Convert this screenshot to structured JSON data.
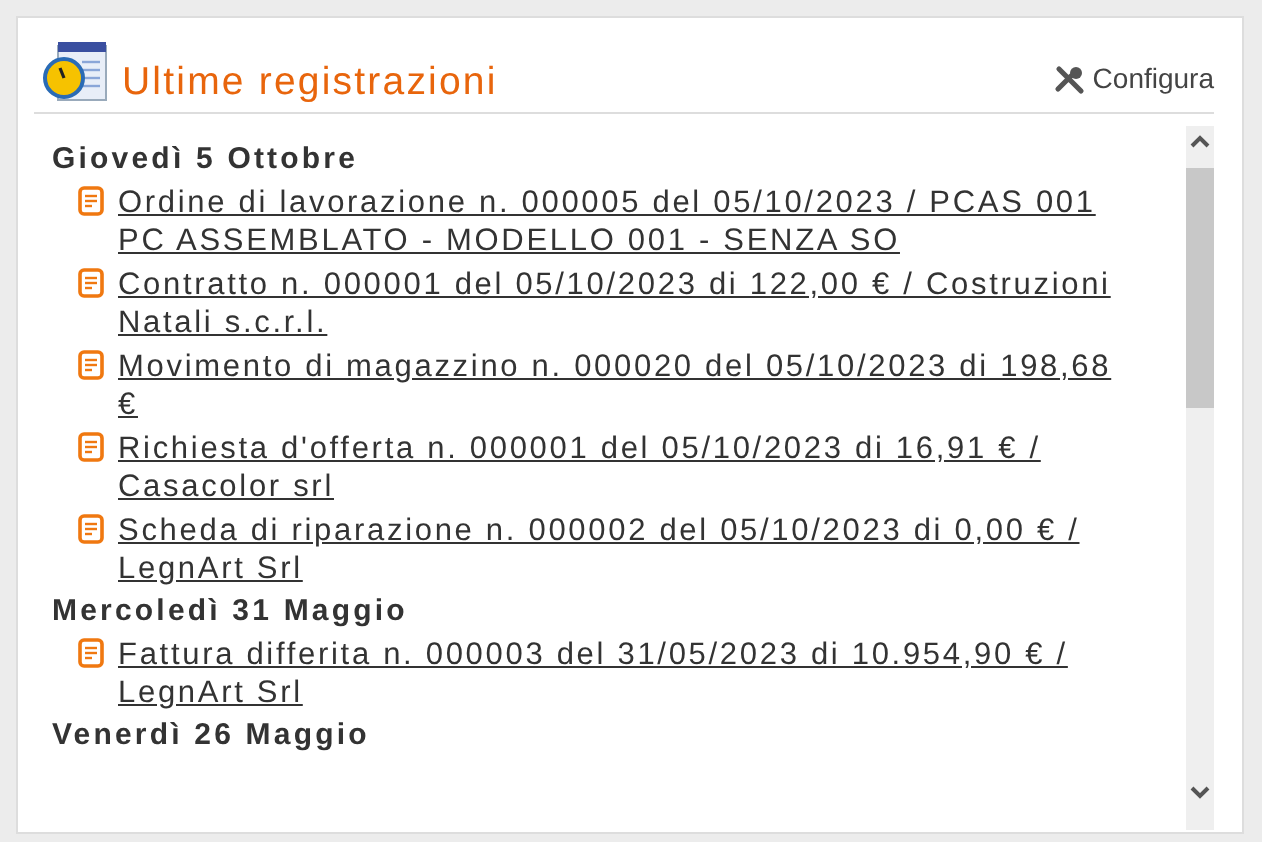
{
  "widget": {
    "title": "Ultime registrazioni",
    "action": "Configura"
  },
  "groups": [
    {
      "date": "Giovedì 5 Ottobre",
      "items": [
        "Ordine di lavorazione n. 000005 del 05/10/2023 / PCAS 001 PC ASSEMBLATO - MODELLO 001 - SENZA SO",
        "Contratto n. 000001 del 05/10/2023 di 122,00 € / Costruzioni Natali s.c.r.l.",
        "Movimento di magazzino n. 000020 del 05/10/2023 di 198,68 €",
        "Richiesta d'offerta n. 000001 del 05/10/2023 di 16,91 € / Casacolor srl",
        "Scheda di riparazione n. 000002 del 05/10/2023 di 0,00 € / LegnArt Srl"
      ]
    },
    {
      "date": "Mercoledì 31 Maggio",
      "items": [
        "Fattura differita n. 000003 del 31/05/2023 di 10.954,90 € / LegnArt Srl"
      ]
    },
    {
      "date": "Venerdì 26 Maggio"
    }
  ]
}
